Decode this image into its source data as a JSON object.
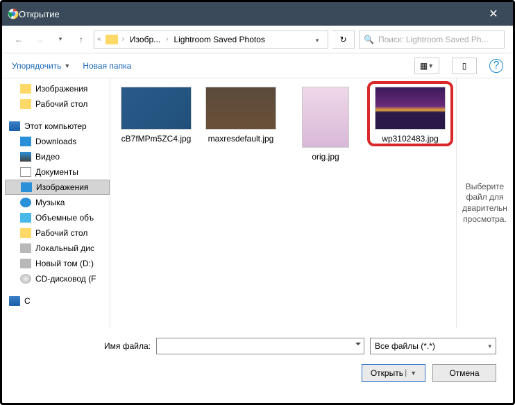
{
  "titlebar": {
    "title": "Открытие"
  },
  "breadcrumb": {
    "part1": "Изобр...",
    "part2": "Lightroom Saved Photos"
  },
  "search": {
    "placeholder": "Поиск: Lightroom Saved Ph..."
  },
  "toolbar": {
    "organize": "Упорядочить",
    "newfolder": "Новая папка"
  },
  "tree": {
    "images_top": "Изображения",
    "desktop_top": "Рабочий стол",
    "this_pc": "Этот компьютер",
    "downloads": "Downloads",
    "video": "Видео",
    "documents": "Документы",
    "images": "Изображения",
    "music": "Музыка",
    "obj3d": "Объемные объ",
    "desktop": "Рабочий стол",
    "localdisk": "Локальный дис",
    "voltd": "Новый том (D:)",
    "cddrive": "CD-дисковод (F",
    "network": "С"
  },
  "files": [
    {
      "name": "cB7fMPm5ZC4.jpg"
    },
    {
      "name": "maxresdefault.jpg"
    },
    {
      "name": "orig.jpg"
    },
    {
      "name": "wp3102483.jpg"
    }
  ],
  "preview": {
    "text": "Выберите файл для дварительн просмотра."
  },
  "footer": {
    "filename_label": "Имя файла:",
    "filter": "Все файлы (*.*)",
    "open": "Открыть",
    "cancel": "Отмена"
  }
}
